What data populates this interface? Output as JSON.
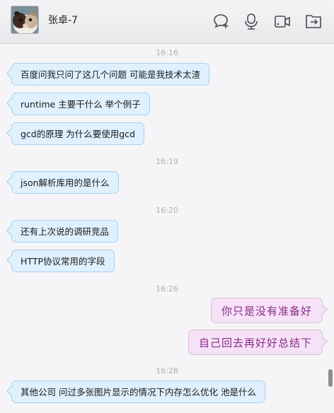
{
  "header": {
    "contact_name": "张卓-7",
    "icons": [
      "chat-add-icon",
      "microphone-icon",
      "video-camera-icon",
      "share-folder-icon"
    ]
  },
  "messages": [
    {
      "type": "time",
      "text": "16:16"
    },
    {
      "type": "in",
      "text": "百度问我只问了这几个问题 可能是我技术太渣"
    },
    {
      "type": "in",
      "text": "runtime 主要干什么 举个例子"
    },
    {
      "type": "in",
      "text": "gcd的原理 为什么要使用gcd"
    },
    {
      "type": "time",
      "text": "16:19"
    },
    {
      "type": "in",
      "text": "json解析库用的是什么"
    },
    {
      "type": "time",
      "text": "16:20"
    },
    {
      "type": "in",
      "text": "还有上次说的调研竞品"
    },
    {
      "type": "in",
      "text": "HTTP协议常用的字段"
    },
    {
      "type": "time",
      "text": "16:26"
    },
    {
      "type": "out",
      "text": "你只是没有准备好"
    },
    {
      "type": "out",
      "text": "自己回去再好好总结下"
    },
    {
      "type": "time",
      "text": "16:28"
    },
    {
      "type": "in",
      "text": "其他公司 问过多张图片显示的情况下内存怎么优化  池是什么"
    }
  ],
  "colors": {
    "incoming_bg": "#dff0fe",
    "incoming_border": "#a9cfee",
    "outgoing_bg": "#f6e2f6",
    "outgoing_text": "#8a2a8a"
  }
}
